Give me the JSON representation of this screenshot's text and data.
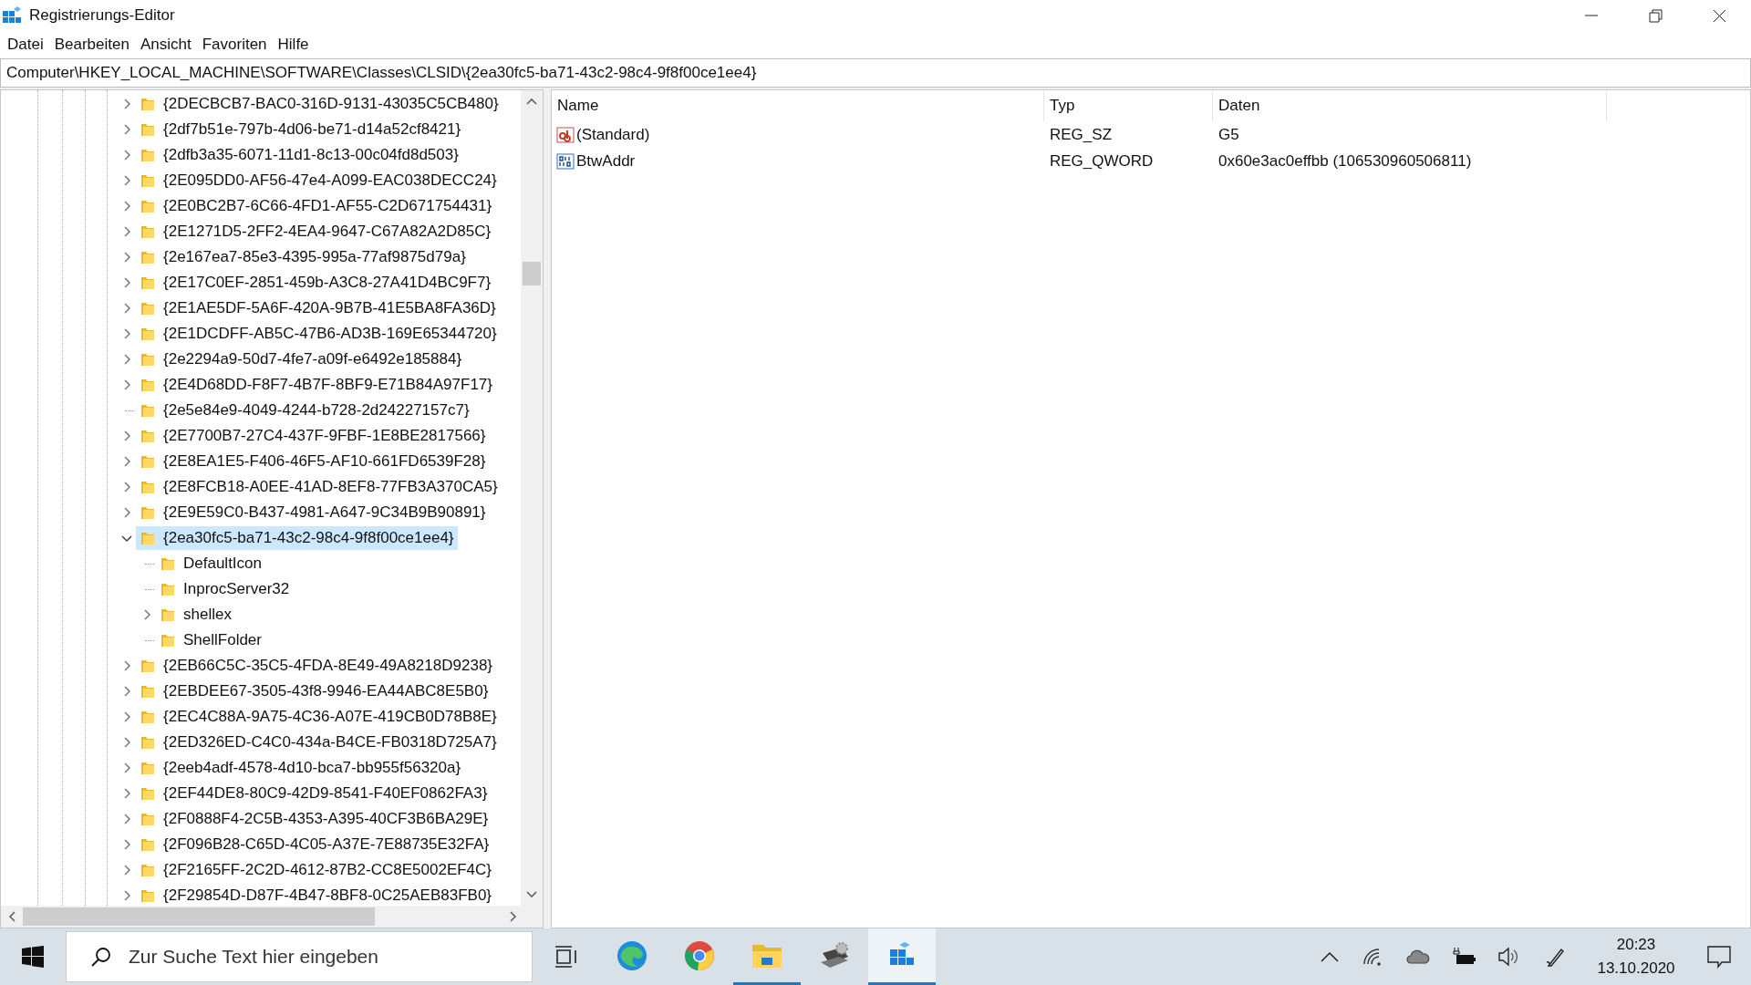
{
  "window": {
    "title": "Registrierungs-Editor"
  },
  "menu": [
    "Datei",
    "Bearbeiten",
    "Ansicht",
    "Favoriten",
    "Hilfe"
  ],
  "address": "Computer\\HKEY_LOCAL_MACHINE\\SOFTWARE\\Classes\\CLSID\\{2ea30fc5-ba71-43c2-98c4-9f8f00ce1ee4}",
  "tree": [
    {
      "name": "{2DECBCB7-BAC0-316D-9131-43035C5CB480}",
      "expandable": true,
      "expanded": false,
      "selected": false
    },
    {
      "name": "{2df7b51e-797b-4d06-be71-d14a52cf8421}",
      "expandable": true,
      "expanded": false,
      "selected": false
    },
    {
      "name": "{2dfb3a35-6071-11d1-8c13-00c04fd8d503}",
      "expandable": true,
      "expanded": false,
      "selected": false
    },
    {
      "name": "{2E095DD0-AF56-47e4-A099-EAC038DECC24}",
      "expandable": true,
      "expanded": false,
      "selected": false
    },
    {
      "name": "{2E0BC2B7-6C66-4FD1-AF55-C2D671754431}",
      "expandable": true,
      "expanded": false,
      "selected": false
    },
    {
      "name": "{2E1271D5-2FF2-4EA4-9647-C67A82A2D85C}",
      "expandable": true,
      "expanded": false,
      "selected": false
    },
    {
      "name": "{2e167ea7-85e3-4395-995a-77af9875d79a}",
      "expandable": true,
      "expanded": false,
      "selected": false
    },
    {
      "name": "{2E17C0EF-2851-459b-A3C8-27A41D4BC9F7}",
      "expandable": true,
      "expanded": false,
      "selected": false
    },
    {
      "name": "{2E1AE5DF-5A6F-420A-9B7B-41E5BA8FA36D}",
      "expandable": true,
      "expanded": false,
      "selected": false
    },
    {
      "name": "{2E1DCDFF-AB5C-47B6-AD3B-169E65344720}",
      "expandable": true,
      "expanded": false,
      "selected": false
    },
    {
      "name": "{2e2294a9-50d7-4fe7-a09f-e6492e185884}",
      "expandable": true,
      "expanded": false,
      "selected": false
    },
    {
      "name": "{2E4D68DD-F8F7-4B7F-8BF9-E71B84A97F17}",
      "expandable": true,
      "expanded": false,
      "selected": false
    },
    {
      "name": "{2e5e84e9-4049-4244-b728-2d24227157c7}",
      "expandable": false,
      "expanded": false,
      "selected": false
    },
    {
      "name": "{2E7700B7-27C4-437F-9FBF-1E8BE2817566}",
      "expandable": true,
      "expanded": false,
      "selected": false
    },
    {
      "name": "{2E8EA1E5-F406-46F5-AF10-661FD6539F28}",
      "expandable": true,
      "expanded": false,
      "selected": false
    },
    {
      "name": "{2E8FCB18-A0EE-41AD-8EF8-77FB3A370CA5}",
      "expandable": true,
      "expanded": false,
      "selected": false
    },
    {
      "name": "{2E9E59C0-B437-4981-A647-9C34B9B90891}",
      "expandable": true,
      "expanded": false,
      "selected": false
    },
    {
      "name": "{2ea30fc5-ba71-43c2-98c4-9f8f00ce1ee4}",
      "expandable": true,
      "expanded": true,
      "selected": true,
      "children": [
        {
          "name": "DefaultIcon",
          "expandable": false,
          "expanded": false,
          "selected": false
        },
        {
          "name": "InprocServer32",
          "expandable": false,
          "expanded": false,
          "selected": false
        },
        {
          "name": "shellex",
          "expandable": true,
          "expanded": false,
          "selected": false
        },
        {
          "name": "ShellFolder",
          "expandable": false,
          "expanded": false,
          "selected": false
        }
      ]
    },
    {
      "name": "{2EB66C5C-35C5-4FDA-8E49-49A8218D9238}",
      "expandable": true,
      "expanded": false,
      "selected": false
    },
    {
      "name": "{2EBDEE67-3505-43f8-9946-EA44ABC8E5B0}",
      "expandable": true,
      "expanded": false,
      "selected": false
    },
    {
      "name": "{2EC4C88A-9A75-4C36-A07E-419CB0D78B8E}",
      "expandable": true,
      "expanded": false,
      "selected": false
    },
    {
      "name": "{2ED326ED-C4C0-434a-B4CE-FB0318D725A7}",
      "expandable": true,
      "expanded": false,
      "selected": false
    },
    {
      "name": "{2eeb4adf-4578-4d10-bca7-bb955f56320a}",
      "expandable": true,
      "expanded": false,
      "selected": false
    },
    {
      "name": "{2EF44DE8-80C9-42D9-8541-F40EF0862FA3}",
      "expandable": true,
      "expanded": false,
      "selected": false
    },
    {
      "name": "{2F0888F4-2C5B-4353-A395-40CF3B6BA29E}",
      "expandable": true,
      "expanded": false,
      "selected": false
    },
    {
      "name": "{2F096B28-C65D-4C05-A37E-7E88735E32FA}",
      "expandable": true,
      "expanded": false,
      "selected": false
    },
    {
      "name": "{2F2165FF-2C2D-4612-87B2-CC8E5002EF4C}",
      "expandable": true,
      "expanded": false,
      "selected": false
    },
    {
      "name": "{2F29854D-D87F-4B47-8BF8-0C25AEB83FB0}",
      "expandable": true,
      "expanded": false,
      "selected": false
    }
  ],
  "values": {
    "columns": [
      "Name",
      "Typ",
      "Daten"
    ],
    "rows": [
      {
        "kind": "string",
        "name": "(Standard)",
        "type": "REG_SZ",
        "data": "G5"
      },
      {
        "kind": "binary",
        "name": "BtwAddr",
        "type": "REG_QWORD",
        "data": "0x60e3ac0effbb (106530960506811)"
      }
    ]
  },
  "taskbar": {
    "search": {
      "placeholder": "Zur Suche Text hier eingeben"
    },
    "apps": [
      {
        "kind": "edge",
        "running": false,
        "selected": false
      },
      {
        "kind": "chrome",
        "running": false,
        "selected": false
      },
      {
        "kind": "explorer",
        "running": true,
        "selected": false
      },
      {
        "kind": "tool",
        "running": false,
        "selected": false
      },
      {
        "kind": "regedit",
        "running": true,
        "selected": true
      }
    ],
    "clock": {
      "time": "20:23",
      "date": "13.10.2020"
    }
  }
}
